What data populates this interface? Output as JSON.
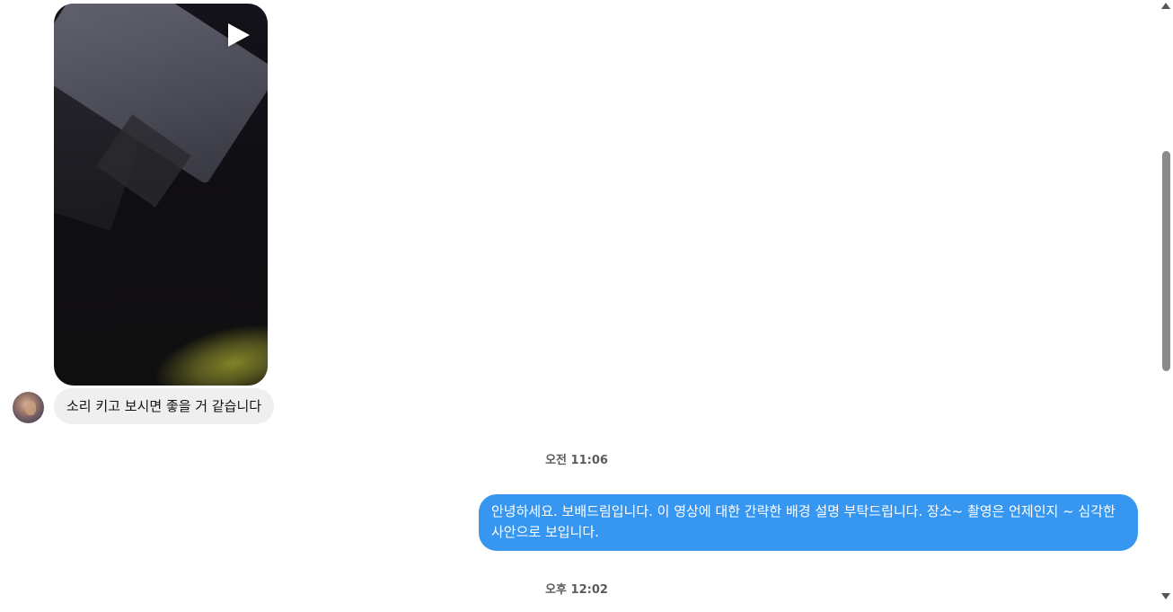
{
  "messages": {
    "video": {
      "icon": "play-icon"
    },
    "incoming_text": "소리 키고 보시면 좋을 거 같습니다",
    "timestamp_1": "오전 11:06",
    "outgoing_text": "안녕하세요. 보배드림입니다. 이 영상에 대한 간략한 배경 설명 부탁드립니다. 장소~ 촬영은 언제인지 ~ 심각한 사안으로 보입니다.",
    "timestamp_2": "오후 12:02"
  },
  "colors": {
    "outgoing_bubble": "#3797f0",
    "incoming_bubble": "#efefef",
    "timestamp_text": "#5c5c5c"
  }
}
